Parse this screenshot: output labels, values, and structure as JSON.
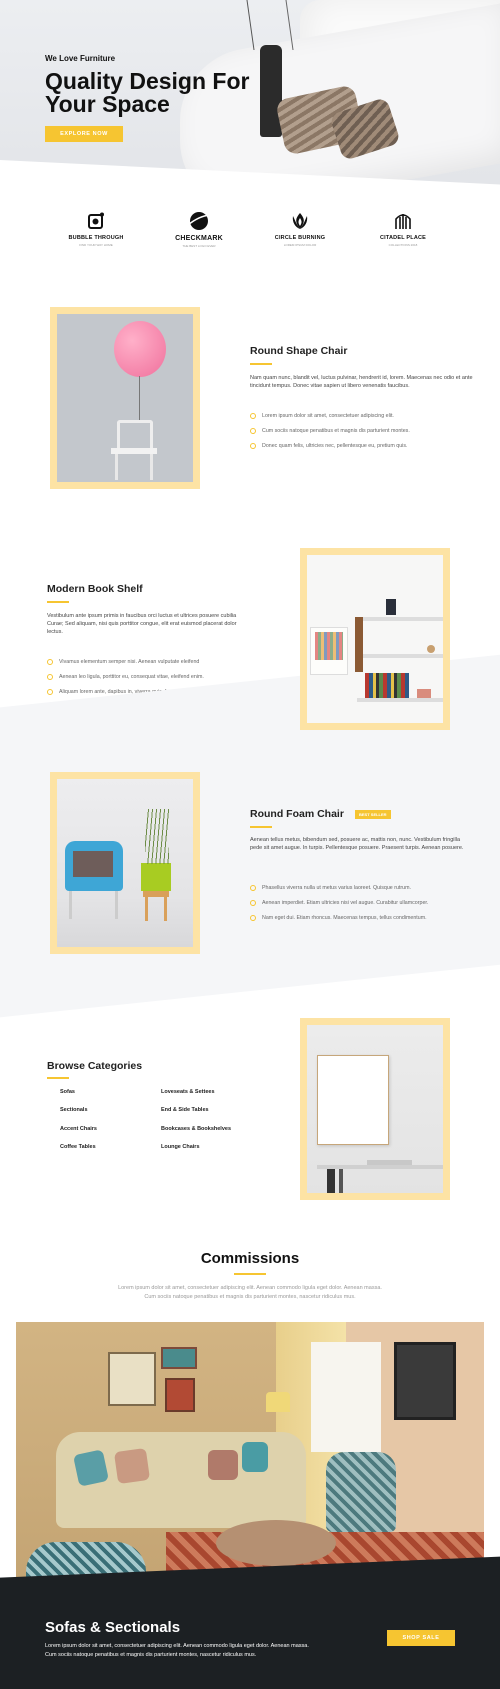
{
  "hero": {
    "eyebrow": "We Love Furniture",
    "title": "Quality Design For Your Space",
    "button": "EXPLORE NOW"
  },
  "logos": [
    {
      "name": "BUBBLE THROUGH",
      "sub": "FIND YOUR WAY HOME",
      "icon": "bubble-icon"
    },
    {
      "name": "CHECKMARK",
      "sub": "THE BEST LOGO EVER",
      "icon": "planet-icon"
    },
    {
      "name": "CIRCLE BURNING",
      "sub": "LOREM IPSUM DOLOR",
      "icon": "flame-icon"
    },
    {
      "name": "CITADEL PLACE",
      "sub": "COLLECTIONS 2018",
      "icon": "citadel-icon"
    }
  ],
  "features": [
    {
      "title": "Round Shape Chair",
      "desc": "Nam quam nunc, blandit vel, luctus pulvinar, hendrerit id, lorem. Maecenas nec odio et ante tincidunt tempus. Donec vitae sapien ut libero venenatis faucibus.",
      "items": [
        "Lorem ipsum dolor sit amet, consectetuer adipiscing elit.",
        "Cum sociis natoque penatibus et magnis dis parturient montes.",
        "Donec quam felis, ultricies nec, pellentesque eu, pretium quis."
      ]
    },
    {
      "title": "Modern Book Shelf",
      "desc": "Vestibulum ante ipsum primis in faucibus orci luctus et ultrices posuere cubilia Curae; Sed aliquam, nisi quis porttitor congue, elit erat euismod placerat dolor lectus.",
      "items": [
        "Vivamus elementum semper nisi. Aenean vulputate eleifend",
        "Aenean leo ligula, porttitor eu, consequat vitae, eleifend enim.",
        "Aliquam lorem ante, dapibus in, viverra quis, feugiat a, tellus."
      ]
    },
    {
      "title": "Round Foam Chair",
      "badge": "BEST SELLER",
      "desc": "Aenean tellus metus, bibendum sed, posuere ac, mattis non, nunc. Vestibulum fringilla pede sit amet augue. In turpis. Pellentesque posuere. Praesent turpis. Aenean posuere.",
      "items": [
        "Phasellus viverra nulla ut metus varius laoreet. Quisque rutrum.",
        "Aenean imperdiet. Etiam ultricies nisi vel augue. Curabitur ullamcorper.",
        "Nam eget dui. Etiam rhoncus. Maecenas tempus, tellus condimentum."
      ]
    }
  ],
  "categories": {
    "title": "Browse Categories",
    "left": [
      "Sofas",
      "Sectionals",
      "Accent Chairs",
      "Coffee Tables"
    ],
    "right": [
      "Loveseats & Settees",
      "End & Side Tables",
      "Bookcases & Bookshelves",
      "Lounge Chairs"
    ]
  },
  "commissions": {
    "title": "Commissions",
    "desc": "Lorem ipsum dolor sit amet, consectetuer adipiscing elit. Aenean commodo ligula eget dolor. Aenean massa. Cum sociis natoque penatibus et magnis dis parturient montes, nascetur ridiculus mus."
  },
  "footer": {
    "title": "Sofas & Sectionals",
    "desc": "Lorem ipsum dolor sit amet, consectetuer adipiscing elit. Aenean commodo ligula eget dolor. Aenean massa. Cum sociis natoque penatibus et magnis dis parturient montes, nascetur ridiculus mus.",
    "button": "SHOP SALE"
  },
  "colors": {
    "accent": "#f6c531",
    "frame": "#fde3a4",
    "dark": "#1c2023"
  }
}
